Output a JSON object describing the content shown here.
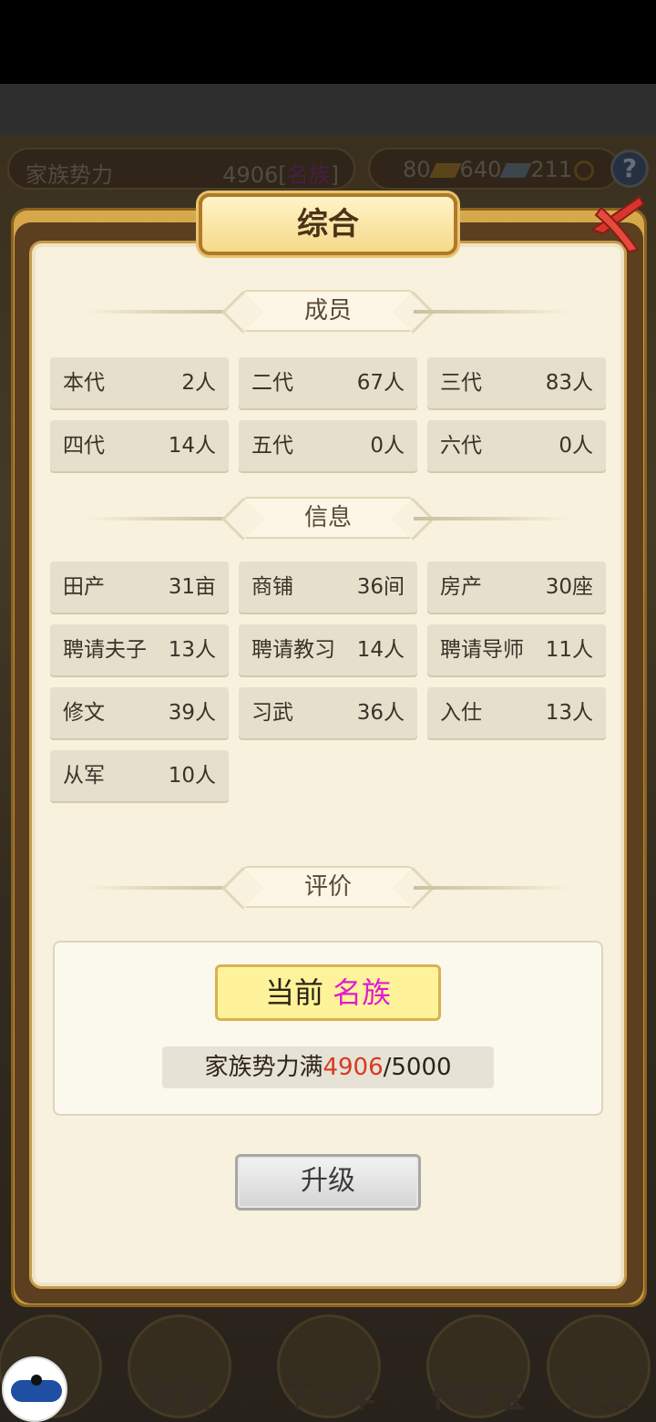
{
  "topbar": {
    "power_label": "家族势力",
    "power_value": "4906",
    "rank_open": "[",
    "rank_name": "名族",
    "rank_close": "]",
    "gold": "80",
    "silver": "640",
    "coins": "211",
    "help_label": "?"
  },
  "dialog": {
    "title": "综合",
    "sections": {
      "members": "成员",
      "info": "信息",
      "evaluation": "评价"
    },
    "members": [
      {
        "label": "本代",
        "value": "2人"
      },
      {
        "label": "二代",
        "value": "67人"
      },
      {
        "label": "三代",
        "value": "83人"
      },
      {
        "label": "四代",
        "value": "14人"
      },
      {
        "label": "五代",
        "value": "0人"
      },
      {
        "label": "六代",
        "value": "0人"
      }
    ],
    "info": [
      {
        "label": "田产",
        "value": "31亩"
      },
      {
        "label": "商铺",
        "value": "36间"
      },
      {
        "label": "房产",
        "value": "30座"
      },
      {
        "label": "聘请夫子",
        "value": "13人"
      },
      {
        "label": "聘请教习",
        "value": "14人"
      },
      {
        "label": "聘请导师",
        "value": "11人"
      },
      {
        "label": "修文",
        "value": "39人"
      },
      {
        "label": "习武",
        "value": "36人"
      },
      {
        "label": "入仕",
        "value": "13人"
      },
      {
        "label": "从军",
        "value": "10人"
      }
    ],
    "evaluation": {
      "current_label": "当前",
      "rank": "名族",
      "progress_prefix": "家族势力满",
      "progress_current": "4906",
      "progress_max": "/5000"
    },
    "upgrade_label": "升级"
  },
  "bottom_nav": [
    {
      "label": "合"
    },
    {
      "label": "家族"
    },
    {
      "label": "下一年"
    },
    {
      "label": "传家宝"
    },
    {
      "label": "分工"
    }
  ],
  "colors": {
    "rank_highlight": "#e01bd0",
    "progress_current": "#d8391f",
    "panel_bg": "#f7f1dd",
    "cell_bg": "#e6dfcc"
  }
}
